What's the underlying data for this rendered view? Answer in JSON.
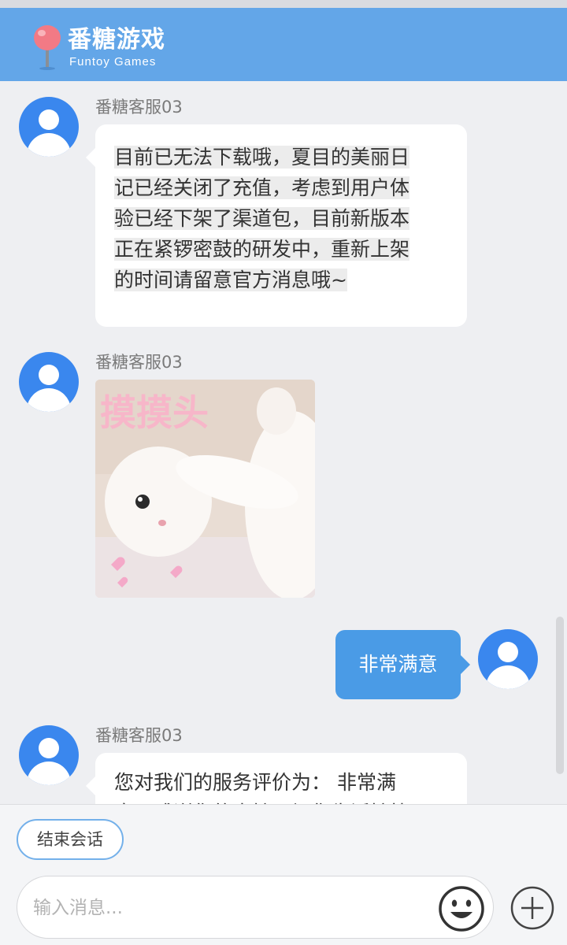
{
  "header": {
    "logo_title": "番糖游戏",
    "logo_subtitle": "Funtoy Games",
    "background": "#63a6e8"
  },
  "messages": [
    {
      "sender": "agent",
      "name": "番糖客服03",
      "lines": [
        "目前已无法下载哦，夏目的美丽日",
        "记已经关闭了充值，考虑到用户体",
        "验已经下架了渠道包，目前新版本",
        "正在紧锣密鼓的研发中，重新上架",
        "的时间请留意官方消息哦~"
      ]
    },
    {
      "sender": "agent",
      "name": "番糖客服03",
      "sticker_text": "摸摸头"
    },
    {
      "sender": "user",
      "text": "非常满意"
    },
    {
      "sender": "agent",
      "name": "番糖客服03",
      "lines": [
        "您对我们的服务评价为： 非常满",
        "意，感谢您的支持，祝您生活愉快"
      ]
    }
  ],
  "footer": {
    "end_button": "结束会话",
    "input_placeholder": "输入消息...",
    "emoji_icon": "emoji-icon",
    "plus_icon": "plus-icon"
  },
  "colors": {
    "accent": "#4a9be6",
    "avatar": "#3a87ee",
    "background": "#eeeff2"
  }
}
